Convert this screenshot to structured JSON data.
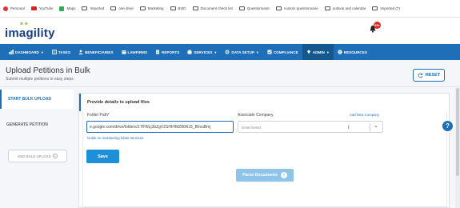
{
  "bookmarks": [
    {
      "label": "Personal",
      "icon": "favicon-icon"
    },
    {
      "label": "YouTube",
      "icon": "youtube-icon"
    },
    {
      "label": "Maps",
      "icon": "maps-icon"
    },
    {
      "label": "Imported",
      "icon": "folder-icon"
    },
    {
      "label": "one drive",
      "icon": "folder-icon"
    },
    {
      "label": "Marketing",
      "icon": "folder-icon"
    },
    {
      "label": "B2ID",
      "icon": "folder-icon"
    },
    {
      "label": "Document check list",
      "icon": "folder-icon"
    },
    {
      "label": "Questionnaire",
      "icon": "folder-icon"
    },
    {
      "label": "custom questionnaire",
      "icon": "folder-icon"
    },
    {
      "label": "outlook and calendar",
      "icon": "folder-icon"
    },
    {
      "label": "Imported (7)",
      "icon": "folder-icon"
    }
  ],
  "header": {
    "logo_text": "imagility",
    "notification_count": "99+"
  },
  "nav": {
    "items": [
      {
        "label": "DASHBOARD",
        "caret": true,
        "icon": "dashboard-icon"
      },
      {
        "label": "TASKS",
        "caret": false,
        "icon": "tasks-icon"
      },
      {
        "label": "BENEFICIARIES",
        "caret": false,
        "icon": "beneficiaries-icon"
      },
      {
        "label": "LAWFIRMS",
        "caret": false,
        "icon": "lawfirms-icon"
      },
      {
        "label": "REPORTS",
        "caret": false,
        "icon": "reports-icon"
      },
      {
        "label": "SERVICES",
        "caret": true,
        "icon": "services-icon"
      },
      {
        "label": "DATA SETUP",
        "caret": true,
        "icon": "data-setup-icon"
      },
      {
        "label": "COMPLIANCE",
        "caret": false,
        "icon": "compliance-icon"
      },
      {
        "label": "ADMIN",
        "caret": true,
        "icon": "admin-icon"
      },
      {
        "label": "RESOURCES",
        "caret": false,
        "icon": "resources-icon"
      }
    ]
  },
  "page": {
    "title": "Upload Petitions in Bulk",
    "subtitle": "Submit multiple petitions in easy steps",
    "reset_label": "RESET"
  },
  "steps": {
    "start_bulk_upload": "START BULK UPLOAD",
    "generate_petition": "GENERATE PETITION",
    "disabled_button": "END BULK UPLOAD"
  },
  "form": {
    "card_title": "Provide details to upload files",
    "folder_path_label": "Folder Path*",
    "folder_path_value": "e.google.com/drive/folders/1TfH9Lj3bZgV2SHIHMZ86RJ3_BhvuBmj",
    "guide_link": "Guide on maintaining folder structure",
    "associate_label": "Associate Company",
    "associate_placeholder": "Enter/Select",
    "add_company_link": "Add New Company",
    "save_label": "Save",
    "parse_label": "Parse Documents"
  },
  "colors": {
    "primary": "#1e6fb8",
    "save": "#1e8fd9",
    "parse_disabled": "#8ec4ea",
    "badge": "#e02828"
  }
}
